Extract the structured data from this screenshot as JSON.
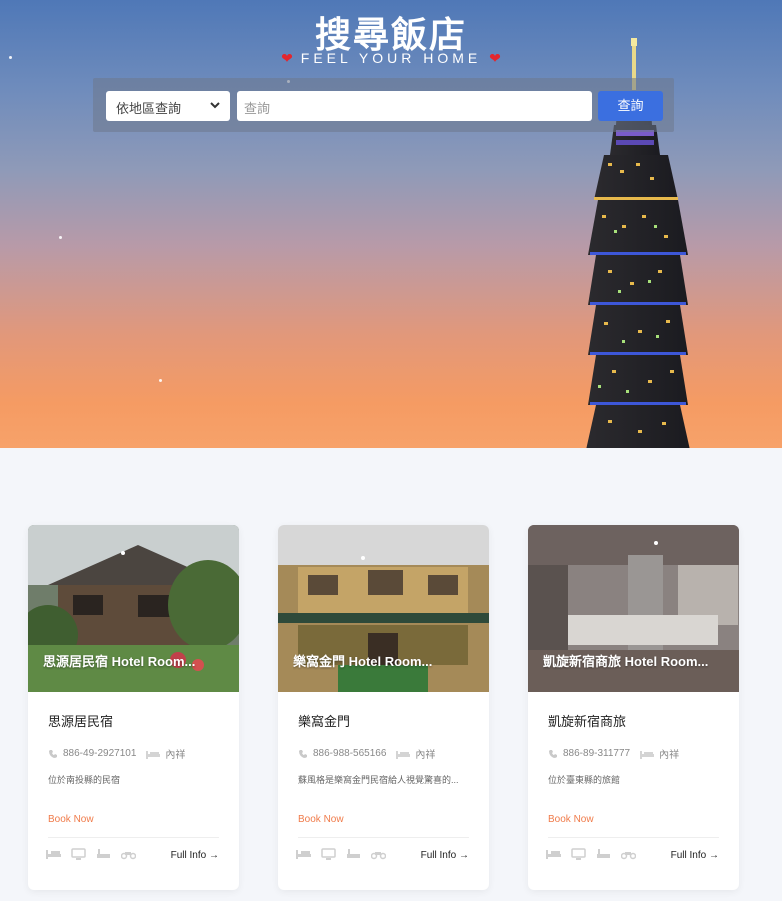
{
  "header": {
    "title": "搜尋飯店",
    "subtitle": "FEEL YOUR HOME"
  },
  "search": {
    "region_select_value": "依地區查詢",
    "input_placeholder": "查詢",
    "button_label": "查詢"
  },
  "hotels": [
    {
      "image_title": "思源居民宿 Hotel Room...",
      "name": "思源居民宿",
      "phone": "886-49-2927101",
      "detail_label": "內祥",
      "description": "位於南投縣的民宿",
      "book_label": "Book Now",
      "full_info_label": "Full Info →"
    },
    {
      "image_title": "樂窩金門 Hotel Room...",
      "name": "樂窩金門",
      "phone": "886-988-565166",
      "detail_label": "內祥",
      "description": "蘇風格是樂窩金門民宿給人視覺驚喜的...",
      "book_label": "Book Now",
      "full_info_label": "Full Info →"
    },
    {
      "image_title": "凱旋新宿商旅 Hotel Room...",
      "name": "凱旋新宿商旅",
      "phone": "886-89-311777",
      "detail_label": "內祥",
      "description": "位於臺東縣的旅館",
      "book_label": "Book Now",
      "full_info_label": "Full Info →"
    }
  ],
  "colors": {
    "accent": "#3b6fe0",
    "book_now": "#f07b4a",
    "heart": "#e3262d"
  },
  "icons": [
    "phone-icon",
    "bed-icon",
    "tv-icon",
    "bathtub-icon",
    "motorcycle-icon",
    "chevron-down-icon",
    "heart-icon"
  ]
}
